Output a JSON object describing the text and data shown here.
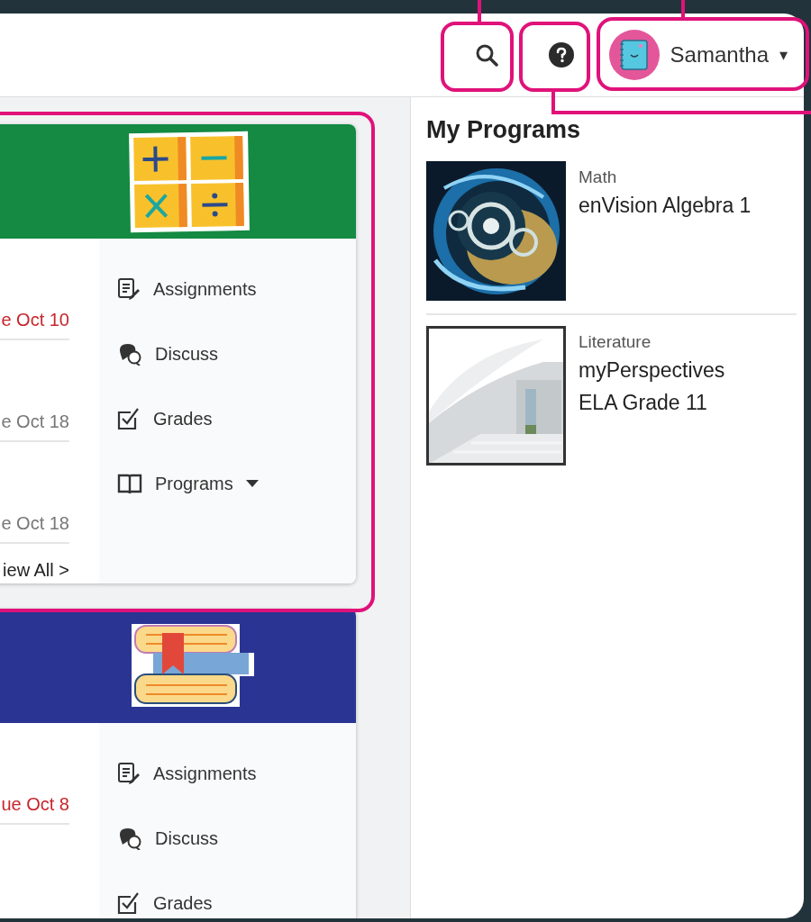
{
  "user": {
    "name": "Samantha",
    "menu_caret": "▾"
  },
  "courses": [
    {
      "color": "#148a43",
      "kind": "math",
      "due_items": [
        {
          "text": "e Oct 10",
          "overdue": true
        },
        {
          "text": "e Oct 18",
          "overdue": false
        },
        {
          "text": "e Oct 18",
          "overdue": false
        }
      ],
      "view_all": "iew All >",
      "links": [
        {
          "kind": "assignments",
          "label": "Assignments"
        },
        {
          "kind": "discuss",
          "label": "Discuss"
        },
        {
          "kind": "grades",
          "label": "Grades"
        },
        {
          "kind": "programs",
          "label": "Programs",
          "dropdown": true
        }
      ]
    },
    {
      "color": "#2a3593",
      "kind": "books",
      "due_items": [
        {
          "text": "ue Oct 8",
          "overdue": true
        }
      ],
      "links": [
        {
          "kind": "assignments",
          "label": "Assignments"
        },
        {
          "kind": "discuss",
          "label": "Discuss"
        },
        {
          "kind": "grades",
          "label": "Grades"
        }
      ]
    }
  ],
  "my_programs": {
    "title": "My Programs",
    "items": [
      {
        "subject": "Math",
        "title_lines": [
          "enVision Algebra 1"
        ],
        "kind": "picture"
      },
      {
        "subject": "Literature",
        "title_lines": [
          "myPerspectives",
          "ELA Grade 11"
        ],
        "kind": "picture"
      }
    ]
  }
}
